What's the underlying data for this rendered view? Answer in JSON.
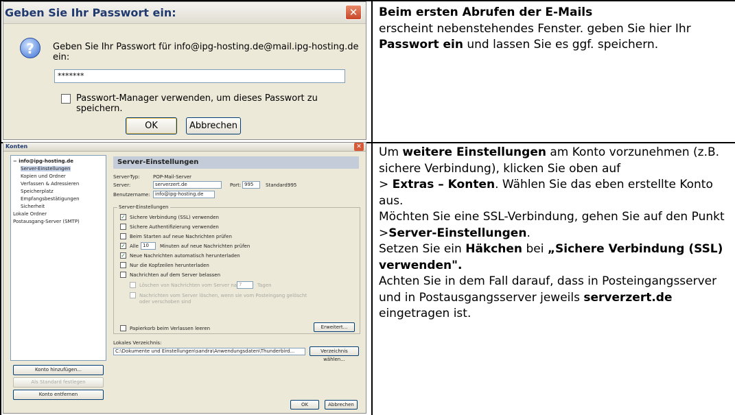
{
  "password_dialog": {
    "title": "Geben Sie Ihr Passwort ein:",
    "close_glyph": "✕",
    "prompt": "Geben Sie Ihr Passwort für info@ipg-hosting.de@mail.ipg-hosting.de ein:",
    "password_value": "*******",
    "checkbox_label": "Passwort-Manager verwenden, um dieses Passwort zu speichern.",
    "ok_label": "OK",
    "cancel_label": "Abbrechen",
    "question_glyph": "?"
  },
  "account_dialog": {
    "title": "Konten",
    "close_glyph": "✕",
    "tree_items": [
      "− info@ipg-hosting.de",
      "Server-Einstellungen",
      "Kopien und Ordner",
      "Verfassen & Adressieren",
      "Speicherplatz",
      "Empfangsbestätigungen",
      "Sicherheit",
      "Lokale Ordner",
      "Postausgang-Server (SMTP)"
    ],
    "header": "Server-Einstellungen",
    "server_type_label": "Server-Typ:",
    "server_type_value": "POP-Mail-Server",
    "server_label": "Server:",
    "server_value": "serverzert.de",
    "port_label": "Port:",
    "port_value": "995",
    "standard_label": "Standard:",
    "standard_value": "995",
    "username_label": "Benutzername:",
    "username_value": "info@ipg-hosting.de",
    "group_label": "Server-Einstellungen",
    "options": [
      "Sichere Verbindung (SSL) verwenden",
      "Sichere Authentifizierung verwenden",
      "Beim Starten auf neue Nachrichten prüfen",
      "Alle",
      "Minuten auf neue Nachrichten prüfen",
      "Neue Nachrichten automatisch herunterladen",
      "Nur die Kopfzeilen herunterladen",
      "Nachrichten auf dem Server belassen",
      "Löschen von Nachrichten vom Server nach",
      "Tagen",
      "Nachrichten vom Server löschen, wenn sie vom Posteingang gelöscht oder verschoben sind",
      "Papierkorb beim Verlassen leeren"
    ],
    "minutes_value": "10",
    "days_value": "7",
    "advanced_button": "Erweitert...",
    "local_dir_label": "Lokales Verzeichnis:",
    "local_dir_value": "C:\\Dokumente und Einstellungen\\sandra\\Anwendungsdaten\\Thunderbird...",
    "choose_dir_button": "Verzeichnis wählen...",
    "add_account_button": "Konto hinzufügen...",
    "set_default_button": "Als Standard festlegen",
    "remove_account_button": "Konto entfernen",
    "ok_button": "OK",
    "cancel_button": "Abbrechen",
    "check_glyph": "✓"
  },
  "instructions_top": {
    "heading": "Beim ersten Abrufen der E-Mails",
    "text_1": " erscheint nebenstehendes Fenster. geben Sie hier Ihr ",
    "bold_1": "Passwort ein",
    "text_2": " und lassen Sie es ggf. speichern."
  },
  "instructions_bottom": {
    "t1": "Um ",
    "b1": "weitere Einstellungen",
    "t2": " am Konto vorzunehmen (z.B. sichere Verbindung), klicken Sie oben auf",
    "t3": "> ",
    "b2": "Extras – Konten",
    "t4": ". Wählen Sie das eben erstellte Konto aus.",
    "t5": "Möchten Sie eine SSL-Verbindung, gehen Sie auf den Punkt",
    "t6": ">",
    "b3": "Server-Einstellungen",
    "t7": ".",
    "t8": "Setzen Sie ein ",
    "b4": "Häkchen",
    "t9": " bei ",
    "b5": "„Sichere Verbindung (SSL) verwenden\".",
    "t10": "Achten Sie in dem Fall darauf, dass in Posteingangsserver und in Postausgangsserver jeweils ",
    "b6": "serverzert.de",
    "t11": " eingetragen ist."
  }
}
